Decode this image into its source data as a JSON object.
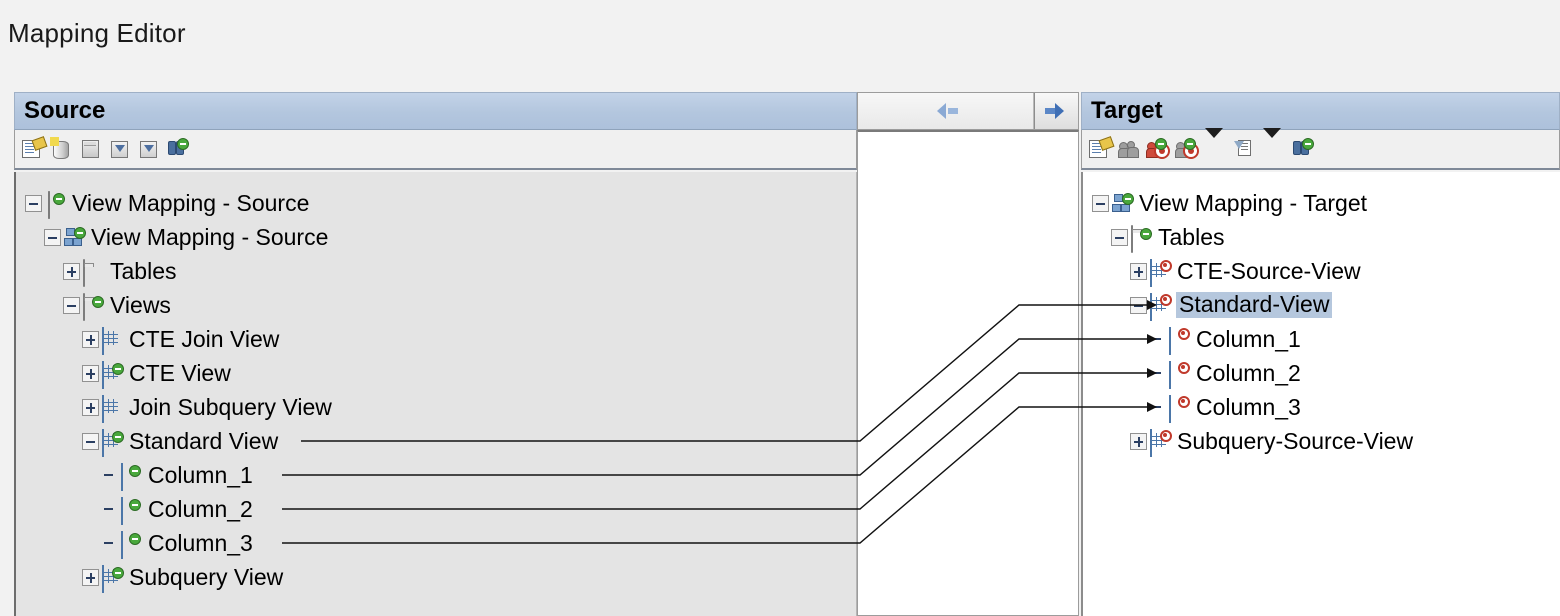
{
  "window": {
    "title": "Mapping Editor"
  },
  "source_panel": {
    "header": "Source",
    "toolbar": [
      {
        "name": "properties-icon",
        "label": "Properties"
      },
      {
        "name": "database-icon",
        "label": "Add Data Source"
      },
      {
        "name": "document-icon",
        "label": "Add Document"
      },
      {
        "name": "import-icon",
        "label": "Import"
      },
      {
        "name": "export-icon",
        "label": "Export"
      },
      {
        "name": "find-icon",
        "label": "Find"
      }
    ],
    "tree": [
      {
        "label": "View Mapping - Source",
        "level": 0,
        "state": "expanded",
        "icon": "database-icon"
      },
      {
        "label": "View Mapping - Source",
        "level": 1,
        "state": "expanded",
        "icon": "schema-icon"
      },
      {
        "label": "Tables",
        "level": 2,
        "state": "collapsed",
        "icon": "folder-icon"
      },
      {
        "label": "Views",
        "level": 2,
        "state": "expanded",
        "icon": "folder-new-icon"
      },
      {
        "label": "CTE Join View",
        "level": 3,
        "state": "collapsed",
        "icon": "view-icon"
      },
      {
        "label": "CTE View",
        "level": 3,
        "state": "collapsed",
        "icon": "view-new-icon"
      },
      {
        "label": "Join Subquery View",
        "level": 3,
        "state": "collapsed",
        "icon": "view-icon"
      },
      {
        "label": "Standard View",
        "level": 3,
        "state": "expanded",
        "icon": "view-new-icon"
      },
      {
        "label": "Column_1",
        "level": 4,
        "state": "leaf",
        "icon": "column-icon"
      },
      {
        "label": "Column_2",
        "level": 4,
        "state": "leaf",
        "icon": "column-icon"
      },
      {
        "label": "Column_3",
        "level": 4,
        "state": "leaf",
        "icon": "column-icon"
      },
      {
        "label": "Subquery View",
        "level": 3,
        "state": "collapsed",
        "icon": "view-new-icon"
      }
    ]
  },
  "middle_panel": {
    "map_left_button": "map-left-arrow",
    "map_right_button": "map-right-arrow"
  },
  "target_panel": {
    "header": "Target",
    "toolbar": [
      {
        "name": "properties-icon",
        "label": "Properties"
      },
      {
        "name": "users-icon",
        "label": "Objects"
      },
      {
        "name": "unmap-icon",
        "label": "Unmap"
      },
      {
        "name": "map-icon",
        "label": "Map"
      },
      {
        "name": "map-dropdown-icon",
        "label": "Map Options"
      },
      {
        "name": "filter-icon",
        "label": "Filter"
      },
      {
        "name": "filter-dropdown-icon",
        "label": "Filter Options"
      },
      {
        "name": "find-icon",
        "label": "Find"
      }
    ],
    "tree": [
      {
        "label": "View Mapping - Target",
        "level": 0,
        "state": "expanded",
        "icon": "schema-icon",
        "selected": false,
        "linked": false
      },
      {
        "label": "Tables",
        "level": 1,
        "state": "expanded",
        "icon": "folder-new-icon",
        "selected": false,
        "linked": false
      },
      {
        "label": "CTE-Source-View",
        "level": 2,
        "state": "collapsed",
        "icon": "target-view-icon",
        "selected": false,
        "linked": false
      },
      {
        "label": "Standard-View",
        "level": 2,
        "state": "expanded",
        "icon": "target-view-icon",
        "selected": true,
        "linked": true
      },
      {
        "label": "Column_1",
        "level": 3,
        "state": "leaf",
        "icon": "target-column-icon",
        "selected": false,
        "linked": true
      },
      {
        "label": "Column_2",
        "level": 3,
        "state": "leaf",
        "icon": "target-column-icon",
        "selected": false,
        "linked": true
      },
      {
        "label": "Column_3",
        "level": 3,
        "state": "leaf",
        "icon": "target-column-icon",
        "selected": false,
        "linked": true
      },
      {
        "label": "Subquery-Source-View",
        "level": 2,
        "state": "collapsed",
        "icon": "target-view-icon",
        "selected": false,
        "linked": false
      }
    ]
  },
  "mappings": [
    {
      "source": "Standard View",
      "target": "Standard-View"
    },
    {
      "source": "Column_1",
      "target": "Column_1"
    },
    {
      "source": "Column_2",
      "target": "Column_2"
    },
    {
      "source": "Column_3",
      "target": "Column_3"
    }
  ],
  "colors": {
    "header_blue": "#b3c6de",
    "selection_blue": "#b5c7dd",
    "panel_gray": "#e4e4e4",
    "page_gray": "#f2f2f2"
  }
}
